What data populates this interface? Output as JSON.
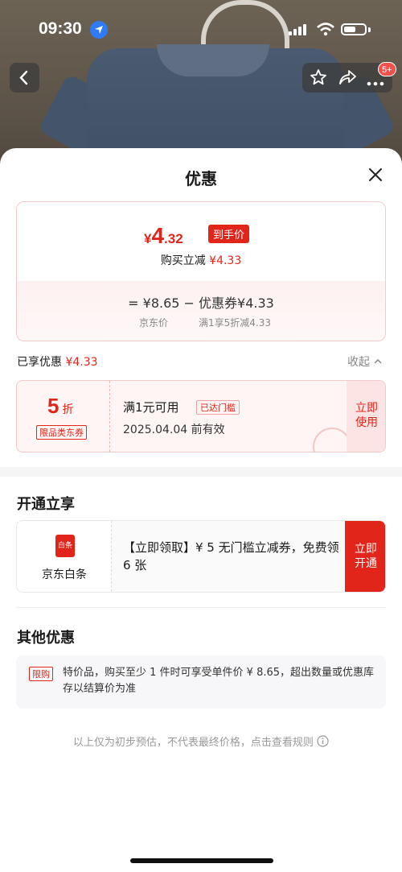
{
  "status_bar": {
    "time": "09:30"
  },
  "nav": {
    "cart_badge": "5+"
  },
  "sheet": {
    "title": "优惠",
    "price": {
      "yen": "¥",
      "integer": "4",
      "decimal": ".32",
      "final_tag": "到手价",
      "buy_minus_label": "购买立减",
      "buy_minus_value": "¥4.33",
      "formula": "=  ¥8.65  −  优惠券¥4.33",
      "sub_jd_price": "京东价",
      "sub_coupon": "满1享5折减4.33"
    },
    "enjoyed": {
      "label": "已享优惠",
      "value": "¥4.33",
      "collapse": "收起"
    },
    "coupon": {
      "discount": "5",
      "discount_unit": "折",
      "type": "限品类东券",
      "condition": "满1元可用",
      "reached": "已达门槛",
      "valid": "2025.04.04 前有效",
      "use_line1": "立即",
      "use_line2": "使用"
    },
    "open_section": {
      "title": "开通立享",
      "icon_text": "白条",
      "name": "京东白条",
      "desc": "【立即领取】¥ 5 无门槛立减券，免费领 6 张",
      "btn_line1": "立即",
      "btn_line2": "开通"
    },
    "other_section": {
      "title": "其他优惠",
      "tag": "限购",
      "text": "特价品，购买至少 1 件时可享受单件价 ¥ 8.65，超出数量或优惠库存以结算价为准"
    },
    "footnote": "以上仅为初步预估，不代表最终价格，点击查看规则"
  },
  "colors": {
    "accent": "#e1251b"
  }
}
